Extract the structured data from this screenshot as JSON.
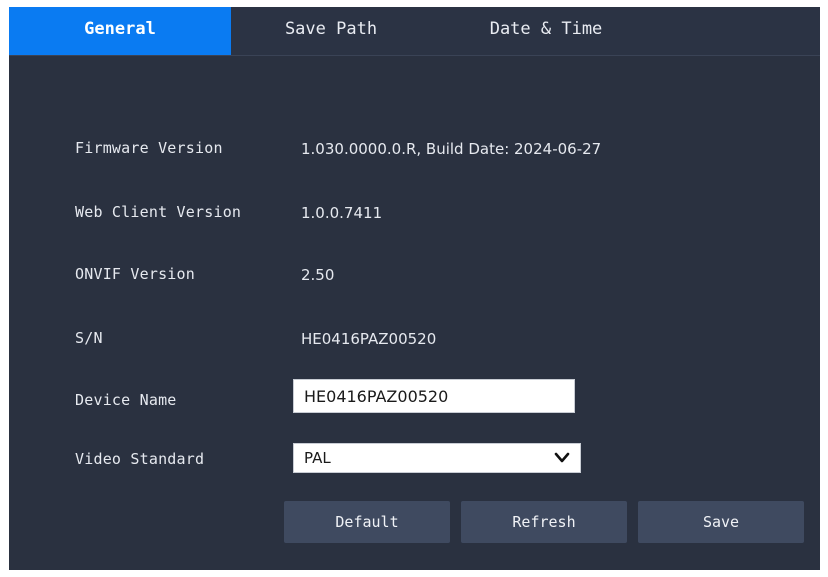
{
  "tabs": [
    {
      "label": "General",
      "active": true
    },
    {
      "label": "Save Path",
      "active": false
    },
    {
      "label": "Date & Time",
      "active": false
    }
  ],
  "info": {
    "firmware": {
      "label": "Firmware Version",
      "value": "1.030.0000.0.R, Build Date: 2024-06-27"
    },
    "web_client": {
      "label": "Web Client Version",
      "value": "1.0.0.7411"
    },
    "onvif": {
      "label": "ONVIF Version",
      "value": "2.50"
    },
    "sn": {
      "label": "S/N",
      "value": "HE0416PAZ00520"
    }
  },
  "device_name": {
    "label": "Device Name",
    "value": "HE0416PAZ00520"
  },
  "video_standard": {
    "label": "Video Standard",
    "selected": "PAL",
    "icon": "chevron-down-icon"
  },
  "buttons": {
    "default": "Default",
    "refresh": "Refresh",
    "save": "Save"
  },
  "colors": {
    "panel_bg": "#2a3140",
    "tab_active": "#0a7bf2",
    "button_bg": "#3f4a60"
  }
}
